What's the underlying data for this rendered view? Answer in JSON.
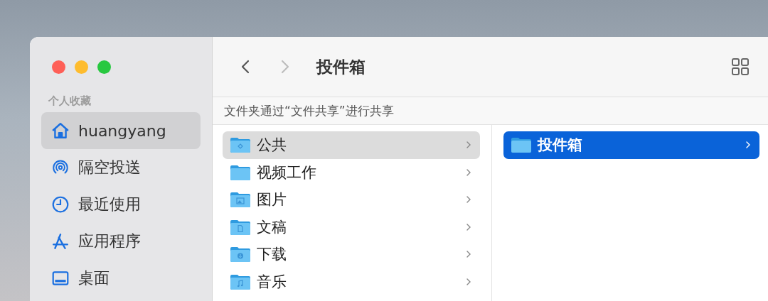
{
  "window": {
    "title": "投件箱",
    "back_enabled": true,
    "forward_enabled": false
  },
  "sidebar": {
    "section": "个人收藏",
    "items": [
      {
        "label": "huangyang",
        "kind": "home",
        "selected": true
      },
      {
        "label": "隔空投送",
        "kind": "airdrop",
        "selected": false
      },
      {
        "label": "最近使用",
        "kind": "recents",
        "selected": false
      },
      {
        "label": "应用程序",
        "kind": "apps",
        "selected": false
      },
      {
        "label": "桌面",
        "kind": "desktop",
        "selected": false
      }
    ]
  },
  "banner": "文件夹通过“文件共享”进行共享",
  "columns": [
    {
      "focused": false,
      "items": [
        {
          "name": "公共",
          "kind": "public",
          "selected": true
        },
        {
          "name": "视频工作",
          "kind": "plain",
          "selected": false
        },
        {
          "name": "图片",
          "kind": "pictures",
          "selected": false
        },
        {
          "name": "文稿",
          "kind": "documents",
          "selected": false
        },
        {
          "name": "下载",
          "kind": "downloads",
          "selected": false
        },
        {
          "name": "音乐",
          "kind": "music",
          "selected": false
        }
      ]
    },
    {
      "focused": true,
      "items": [
        {
          "name": "投件箱",
          "kind": "plain",
          "selected": true
        }
      ]
    }
  ]
}
